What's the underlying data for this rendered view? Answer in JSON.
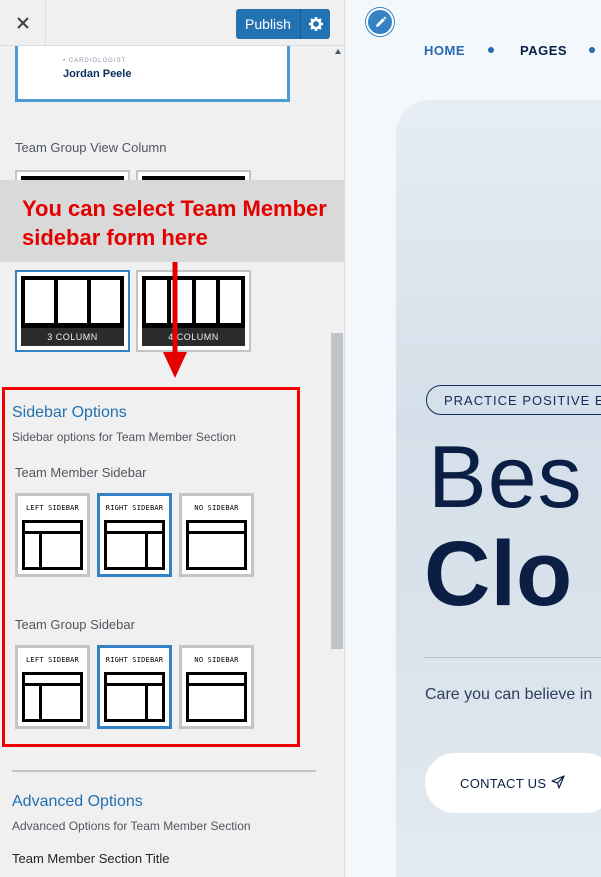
{
  "topbar": {
    "close_icon": "close-icon",
    "publish_label": "Publish",
    "settings_icon": "gear-icon"
  },
  "member_card": {
    "role": "• CARDIOLOGIST",
    "name": "Jordan Peele"
  },
  "group_view_column": {
    "title": "Team Group View Column",
    "options": [
      {
        "label": "3 COLUMN",
        "selected": true
      },
      {
        "label": "4 COLUMN",
        "selected": false
      }
    ]
  },
  "annotation": {
    "text": "You can select Team Member sidebar form here",
    "color": "#e50000"
  },
  "sidebar_options": {
    "title": "Sidebar Options",
    "description": "Sidebar options for Team Member Section",
    "team_member_sidebar": {
      "label": "Team Member Sidebar",
      "options": [
        {
          "label": "LEFT SIDEBAR",
          "selected": false
        },
        {
          "label": "RIGHT SIDEBAR",
          "selected": true
        },
        {
          "label": "NO SIDEBAR",
          "selected": false
        }
      ]
    },
    "team_group_sidebar": {
      "label": "Team Group Sidebar",
      "options": [
        {
          "label": "LEFT SIDEBAR",
          "selected": false
        },
        {
          "label": "RIGHT SIDEBAR",
          "selected": true
        },
        {
          "label": "NO SIDEBAR",
          "selected": false
        }
      ]
    }
  },
  "advanced_options": {
    "title": "Advanced Options",
    "description": "Advanced Options for Team Member Section",
    "field_label": "Team Member Section Title"
  },
  "preview": {
    "edit_icon": "pencil-icon",
    "nav": [
      "HOME",
      "PAGES"
    ],
    "tagline": "PRACTICE POSITIVE EN",
    "headline_line1": "Bes",
    "headline_line2": "Clo",
    "subtext": "Care you can believe in",
    "cta_label": "CONTACT US",
    "cta_icon": "paper-plane-icon",
    "accent_color": "#2869b2",
    "dark_color": "#0b1f44"
  }
}
